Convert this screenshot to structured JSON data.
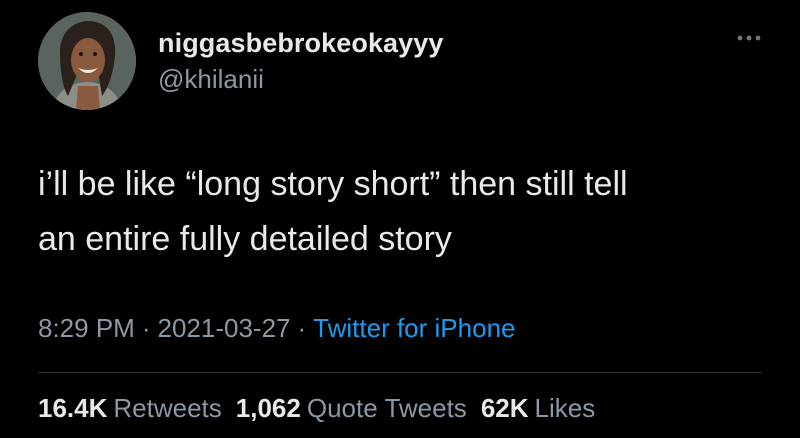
{
  "tweet": {
    "display_name": "niggasbebrokeokayyy",
    "handle": "@khilanii",
    "text_lines": [
      "i’ll be like “long story short” then still tell",
      "an entire fully detailed story"
    ],
    "time": "8:29 PM",
    "date": "2021-03-27",
    "separator": "·",
    "source": "Twitter for iPhone"
  },
  "stats": {
    "retweets": {
      "count": "16.4K",
      "label": "Retweets"
    },
    "quote_tweets": {
      "count": "1,062",
      "label": "Quote Tweets"
    },
    "likes": {
      "count": "62K",
      "label": "Likes"
    }
  },
  "icons": {
    "more": "more-horizontal-icon"
  },
  "colors": {
    "background": "#000000",
    "primary_text": "#e7e9ea",
    "secondary_text": "#8b98a5",
    "link": "#1d9bf0",
    "divider": "#2f3336"
  }
}
